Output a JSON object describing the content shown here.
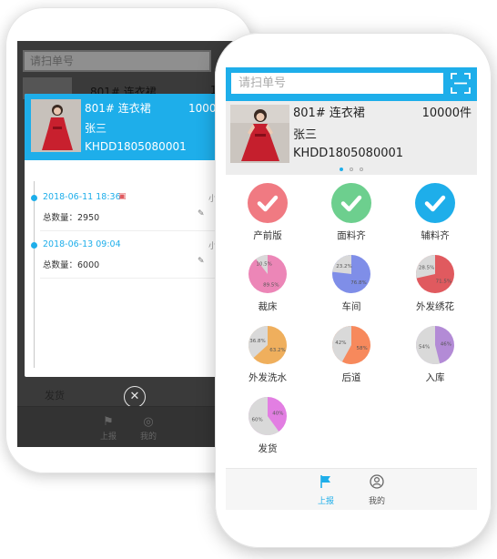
{
  "back": {
    "search_placeholder": "请扫单号",
    "title": "801# 连衣裙",
    "qty": "10000",
    "bottom_label": "发货",
    "modal": {
      "title": "801# 连衣裙",
      "qty": "10000件",
      "name": "张三",
      "code": "KHDD1805080001",
      "records": [
        {
          "date": "2018-06-11 18:36",
          "qty": "总数量：2950",
          "tail": "小"
        },
        {
          "date": "2018-06-13 09:04",
          "qty": "总数量：6000",
          "tail": "小"
        }
      ]
    },
    "nav": [
      {
        "label": "上报",
        "icon": "flag-icon"
      },
      {
        "label": "我的",
        "icon": "user-icon"
      }
    ]
  },
  "front": {
    "search_placeholder": "请扫单号",
    "order": {
      "title": "801# 连衣裙",
      "qty": "10000件",
      "name": "张三",
      "code": "KHDD1805080001"
    },
    "stages": [
      {
        "label": "产前版",
        "kind": "status",
        "color": "#f07a82"
      },
      {
        "label": "面料齐",
        "kind": "status",
        "color": "#6dcf8e"
      },
      {
        "label": "辅料齐",
        "kind": "status",
        "color": "#1eaeea"
      },
      {
        "label": "裁床",
        "kind": "pie",
        "color": "#ec86b7",
        "slice": "10.5%",
        "rest": "89.5%",
        "fraction": 0.105
      },
      {
        "label": "车间",
        "kind": "pie",
        "color": "#7f8ee8",
        "slice": "23.2%",
        "rest": "76.8%",
        "fraction": 0.232
      },
      {
        "label": "外发绣花",
        "kind": "pie",
        "color": "#e05a5f",
        "slice": "28.5%",
        "rest": "71.5%",
        "fraction": 0.285
      },
      {
        "label": "外发洗水",
        "kind": "pie",
        "color": "#efaf5d",
        "slice": "36.8%",
        "rest": "63.2%",
        "fraction": 0.368
      },
      {
        "label": "后道",
        "kind": "pie",
        "color": "#f7895c",
        "slice": "42%",
        "rest": "58%",
        "fraction": 0.42
      },
      {
        "label": "入库",
        "kind": "pie",
        "color": "#b38bd6",
        "slice": "54%",
        "rest": "46%",
        "fraction": 0.54
      },
      {
        "label": "发货",
        "kind": "pie",
        "color": "#e27ee2",
        "slice": "60%",
        "rest": "40%",
        "fraction": 0.6
      }
    ],
    "nav": [
      {
        "label": "上报",
        "icon": "flag-icon",
        "active": true
      },
      {
        "label": "我的",
        "icon": "user-icon",
        "active": false
      }
    ],
    "colors": {
      "accent": "#1eaeea",
      "ring": "#d9d9d9"
    }
  }
}
